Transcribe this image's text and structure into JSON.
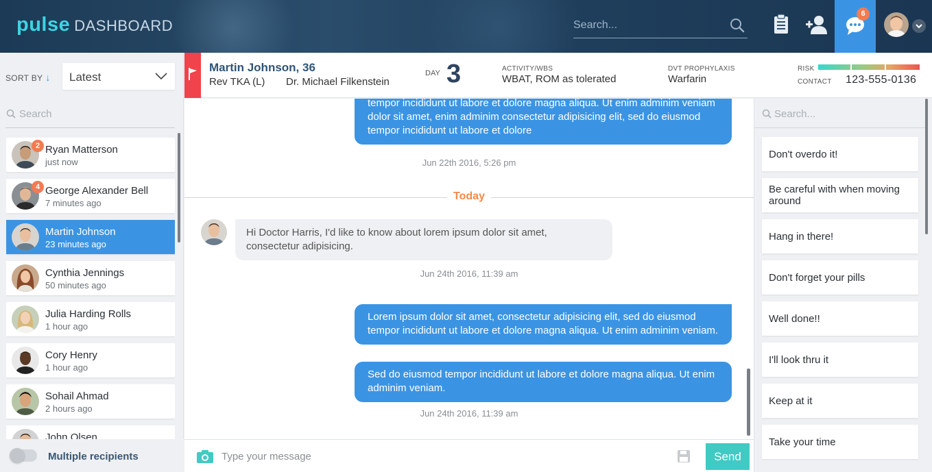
{
  "app": {
    "brand": "pulse",
    "brand_sub": "DASHBOARD"
  },
  "topbar": {
    "search_placeholder": "Search...",
    "chat_badge": "6",
    "icons": [
      "clipboard-icon",
      "add-user-icon",
      "chat-bubble-icon",
      "avatar",
      "chevron-down-icon"
    ]
  },
  "left": {
    "sort_label": "SORT BY",
    "sort_value": "Latest",
    "search_placeholder": "Search",
    "contacts": [
      {
        "name": "Ryan Matterson",
        "time": "just now",
        "badge": "2"
      },
      {
        "name": "George Alexander Bell",
        "time": "7 minutes ago",
        "badge": "4"
      },
      {
        "name": "Martin Johnson",
        "time": "23 minutes ago",
        "active": true
      },
      {
        "name": "Cynthia Jennings",
        "time": "50 minutes ago"
      },
      {
        "name": "Julia Harding Rolls",
        "time": "1 hour ago"
      },
      {
        "name": "Cory Henry",
        "time": "1 hour ago"
      },
      {
        "name": "Sohail Ahmad",
        "time": "2 hours ago"
      },
      {
        "name": "John Olsen",
        "time": ""
      }
    ],
    "multi_label": "Multiple recipients"
  },
  "patient": {
    "name": "Martin Johnson, 36",
    "procedure": "Rev TKA (L)",
    "doctor": "Dr. Michael Filkenstein",
    "day_label": "DAY",
    "day_value": "3",
    "activity_label": "ACTIVITY/WBS",
    "activity_value": "WBAT, ROM as tolerated",
    "dvt_label": "DVT PROPHYLAXIS",
    "dvt_value": "Warfarin",
    "risk_label": "RISK",
    "contact_label": "CONTACT",
    "contact_value": "123-555-0136"
  },
  "chat": {
    "messages": [
      {
        "dir": "out",
        "text": "tempor incididunt ut labore et dolore magna aliqua. Ut enim adminim veniam dolor sit amet, enim adminim consectetur adipisicing elit, sed do eiusmod tempor incididunt ut labore et dolore"
      },
      {
        "stamp": "Jun 22th 2016, 5:26 pm"
      },
      {
        "divider": "Today"
      },
      {
        "dir": "in",
        "text": "Hi Doctor Harris, I'd like to know about lorem ipsum dolor sit amet, consectetur adipisicing."
      },
      {
        "stamp": "Jun 24th 2016, 11:39 am"
      },
      {
        "dir": "out",
        "text": "Lorem ipsum dolor sit amet, consectetur adipisicing elit, sed do eiusmod tempor incididunt ut labore et dolore magna aliqua. Ut enim adminim veniam."
      },
      {
        "dir": "out",
        "text": "Sed do eiusmod tempor incididunt ut labore et dolore magna aliqua. Ut enim adminim veniam."
      },
      {
        "stamp": "Jun 24th 2016, 11:39 am"
      }
    ]
  },
  "compose": {
    "placeholder": "Type your message",
    "send_label": "Send"
  },
  "right": {
    "search_placeholder": "Search...",
    "replies": [
      "Don't overdo it!",
      "Be careful with when moving around",
      "Hang in there!",
      "Don't forget your pills",
      "Well done!!",
      "I'll look thru it",
      "Keep at it",
      "Take your time"
    ]
  },
  "colors": {
    "accent": "#3b94e3",
    "send": "#3fcbc4",
    "badge": "#f27c52",
    "flag": "#f0434b",
    "today": "#f28a4b",
    "brand": "#3ed3e3"
  }
}
